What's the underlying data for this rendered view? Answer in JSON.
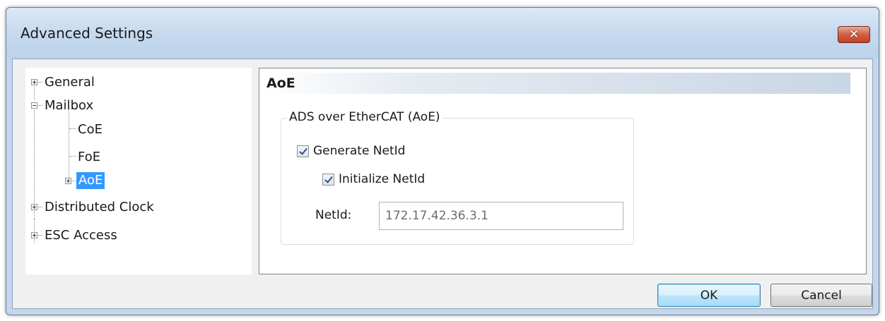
{
  "window": {
    "title": "Advanced Settings",
    "close_icon": "close-x-icon"
  },
  "tree": {
    "items": [
      {
        "label": "General",
        "expander": "plus"
      },
      {
        "label": "Mailbox",
        "expander": "minus"
      },
      {
        "label": "CoE"
      },
      {
        "label": "FoE"
      },
      {
        "label": "AoE",
        "expander": "plus",
        "selected": true
      },
      {
        "label": "Distributed Clock",
        "expander": "plus"
      },
      {
        "label": "ESC Access",
        "expander": "plus"
      }
    ]
  },
  "panel": {
    "header": "AoE",
    "group": {
      "legend": "ADS over EtherCAT (AoE)",
      "generate_netid": {
        "label": "Generate NetId",
        "checked": true
      },
      "initialize_netid": {
        "label": "Initialize NetId",
        "checked": true
      },
      "netid_label": "NetId:",
      "netid_value": "172.17.42.36.3.1"
    }
  },
  "buttons": {
    "ok": "OK",
    "cancel": "Cancel"
  },
  "colors": {
    "selection": "#3399ff",
    "frame": "#c3d6ec",
    "close_button": "#c0422a"
  }
}
